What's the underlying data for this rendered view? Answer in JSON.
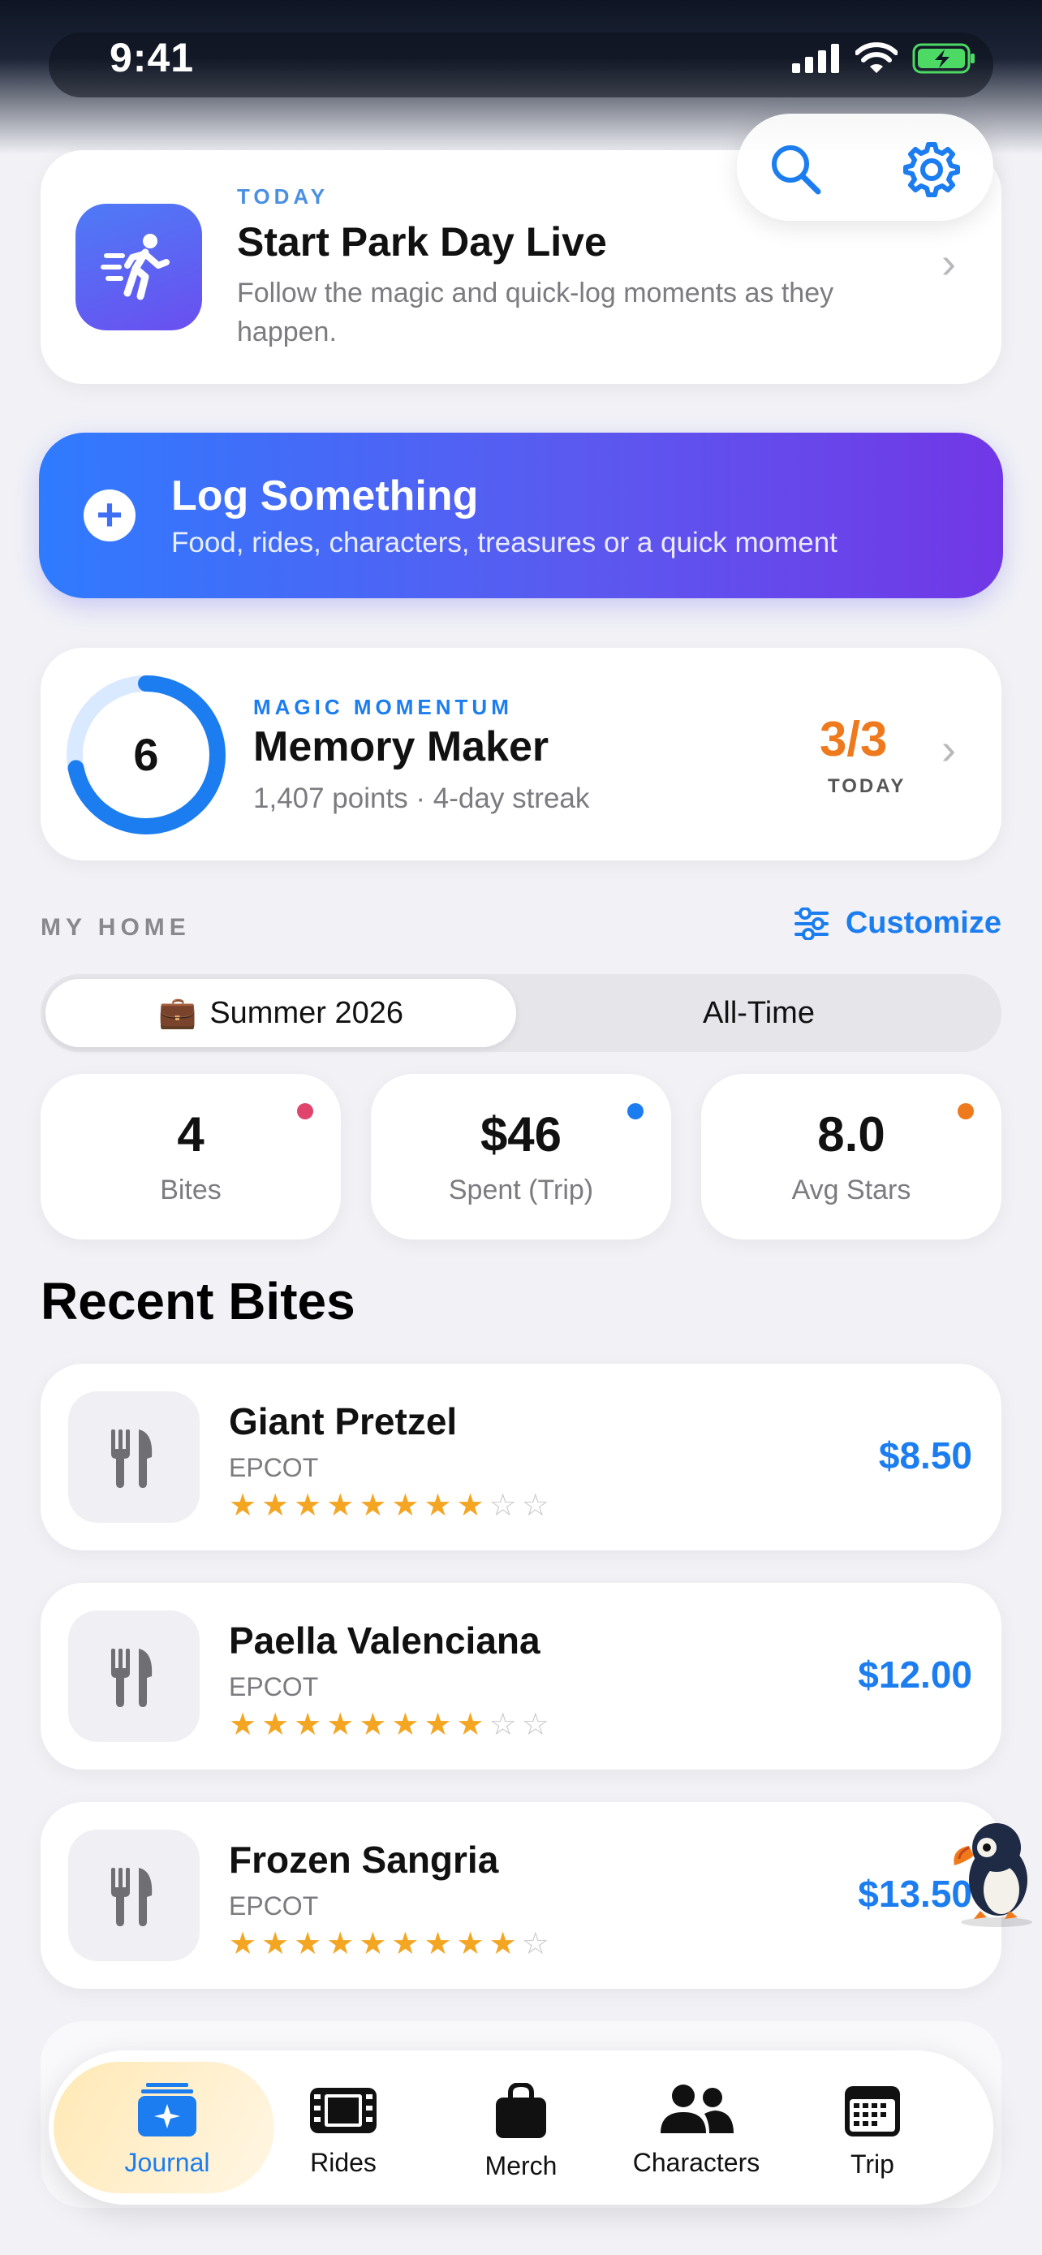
{
  "status": {
    "time": "9:41"
  },
  "park_day": {
    "eyebrow": "TODAY",
    "title": "Start Park Day Live",
    "subtitle": "Follow the magic and quick-log moments as they happen."
  },
  "top_actions": {
    "search_icon": "search-icon",
    "settings_icon": "gear-icon"
  },
  "log": {
    "title": "Log Something",
    "subtitle": "Food, rides, characters, treasures or a quick moment"
  },
  "momentum": {
    "eyebrow": "MAGIC MOMENTUM",
    "level": "6",
    "title": "Memory Maker",
    "subtitle": "1,407 points · 4-day streak",
    "count": "3/3",
    "count_label": "TODAY",
    "ring_progress": 0.72
  },
  "home": {
    "section_label": "MY HOME",
    "customize_label": "Customize",
    "segments": {
      "active_emoji": "💼",
      "active": "Summer 2026",
      "other": "All-Time"
    }
  },
  "stats": [
    {
      "value": "4",
      "label": "Bites",
      "dot_color": "#e0436b"
    },
    {
      "value": "$46",
      "label": "Spent (Trip)",
      "dot_color": "#1b7df0"
    },
    {
      "value": "8.0",
      "label": "Avg Stars",
      "dot_color": "#ef7a1e"
    }
  ],
  "recent": {
    "heading": "Recent Bites",
    "items": [
      {
        "name": "Giant Pretzel",
        "park": "EPCOT",
        "price": "$8.50",
        "stars_filled": 8,
        "stars_total": 10
      },
      {
        "name": "Paella Valenciana",
        "park": "EPCOT",
        "price": "$12.00",
        "stars_filled": 8,
        "stars_total": 10
      },
      {
        "name": "Frozen Sangria",
        "park": "EPCOT",
        "price": "$13.50",
        "stars_filled": 9,
        "stars_total": 10
      }
    ]
  },
  "tabs": [
    {
      "label": "Journal",
      "icon": "journal-icon",
      "active": true
    },
    {
      "label": "Rides",
      "icon": "film-icon",
      "active": false
    },
    {
      "label": "Merch",
      "icon": "bag-icon",
      "active": false
    },
    {
      "label": "Characters",
      "icon": "people-icon",
      "active": false
    },
    {
      "label": "Trip",
      "icon": "calendar-icon",
      "active": false
    }
  ],
  "colors": {
    "accent": "#1b7df0",
    "orange": "#ef7a1e",
    "star": "#f4a623"
  }
}
